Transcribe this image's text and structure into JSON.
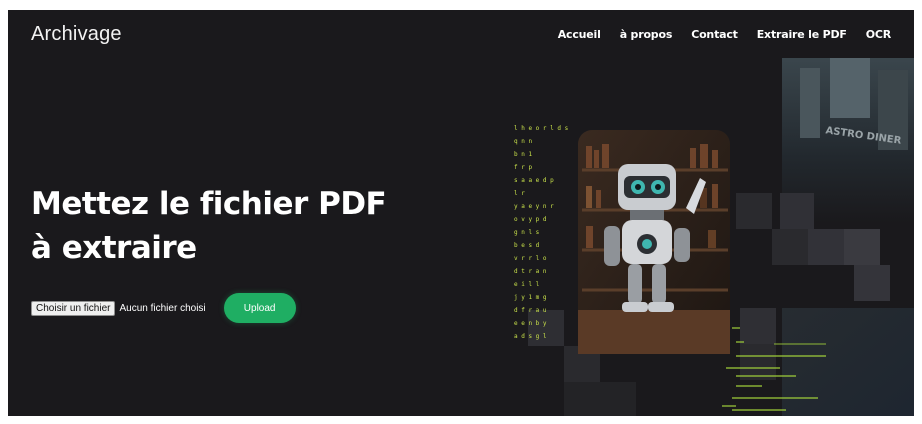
{
  "brand": "Archivage",
  "nav": [
    "Accueil",
    "à propos",
    "Contact",
    "Extraire le PDF",
    "OCR"
  ],
  "hero": {
    "title": "Mettez le fichier PDF à extraire",
    "file_button": "Choisir un fichier",
    "file_status": "Aucun fichier choisi",
    "upload": "Upload"
  },
  "colors": {
    "background": "#1a191c",
    "upload_button": "#1fae63",
    "matrix_text": "#c8e04a"
  },
  "decor": {
    "matrix_text": "l h e o r l d s q n n b n 1 f r p s a a e d p l r y a e y n r o v y p d g n l s b e s d v r r l o d t r a n e i l l j y 1 m g d f r a u e e n b y a d s g l",
    "robot_icon": "robot-illustration",
    "neon_sign": "ASTRO DINER"
  }
}
